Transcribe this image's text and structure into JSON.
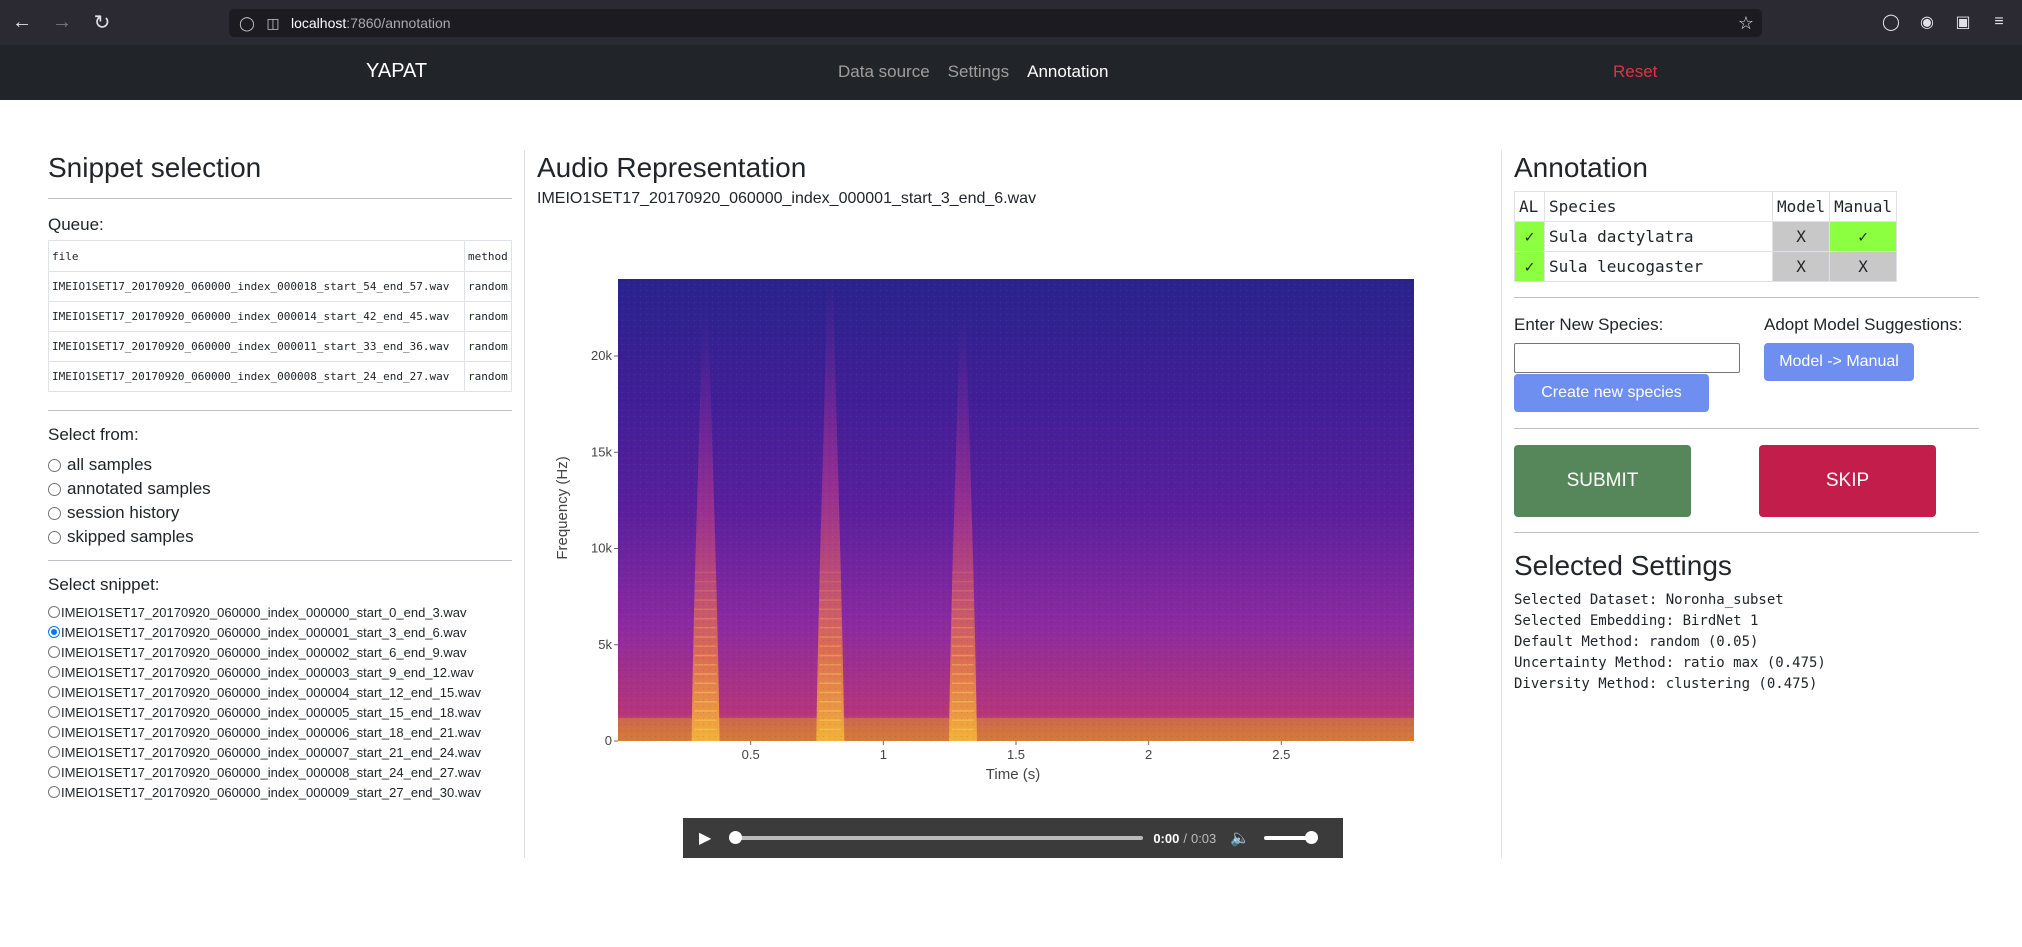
{
  "browser": {
    "url_host": "localhost",
    "url_path": ":7860/annotation"
  },
  "navbar": {
    "brand": "YAPAT",
    "links": [
      {
        "label": "Data source",
        "active": false
      },
      {
        "label": "Settings",
        "active": false
      },
      {
        "label": "Annotation",
        "active": true
      }
    ],
    "reset": "Reset"
  },
  "left": {
    "title": "Snippet selection",
    "queue_label": "Queue:",
    "queue_headers": [
      "file",
      "method"
    ],
    "queue_rows": [
      [
        "IMEIO1SET17_20170920_060000_index_000018_start_54_end_57.wav",
        "random"
      ],
      [
        "IMEIO1SET17_20170920_060000_index_000014_start_42_end_45.wav",
        "random"
      ],
      [
        "IMEIO1SET17_20170920_060000_index_000011_start_33_end_36.wav",
        "random"
      ],
      [
        "IMEIO1SET17_20170920_060000_index_000008_start_24_end_27.wav",
        "random"
      ]
    ],
    "select_from_label": "Select from:",
    "select_from_options": [
      "all samples",
      "annotated samples",
      "session history",
      "skipped samples"
    ],
    "select_snippet_label": "Select snippet:",
    "snippets": [
      "IMEIO1SET17_20170920_060000_index_000000_start_0_end_3.wav",
      "IMEIO1SET17_20170920_060000_index_000001_start_3_end_6.wav",
      "IMEIO1SET17_20170920_060000_index_000002_start_6_end_9.wav",
      "IMEIO1SET17_20170920_060000_index_000003_start_9_end_12.wav",
      "IMEIO1SET17_20170920_060000_index_000004_start_12_end_15.wav",
      "IMEIO1SET17_20170920_060000_index_000005_start_15_end_18.wav",
      "IMEIO1SET17_20170920_060000_index_000006_start_18_end_21.wav",
      "IMEIO1SET17_20170920_060000_index_000007_start_21_end_24.wav",
      "IMEIO1SET17_20170920_060000_index_000008_start_24_end_27.wav",
      "IMEIO1SET17_20170920_060000_index_000009_start_27_end_30.wav"
    ],
    "selected_snippet_index": 1
  },
  "middle": {
    "title": "Audio Representation",
    "filename": "IMEIO1SET17_20170920_060000_index_000001_start_3_end_6.wav",
    "audio": {
      "current": "0:00",
      "separator": "/",
      "duration": "0:03",
      "progress": 0.0,
      "volume": 1.0
    }
  },
  "chart_data": {
    "type": "heatmap",
    "title": "",
    "xlabel": "Time (s)",
    "ylabel": "Frequency (Hz)",
    "xlim": [
      0,
      3
    ],
    "ylim": [
      0,
      24000
    ],
    "x_ticks": [
      0.5,
      1,
      1.5,
      2,
      2.5
    ],
    "x_tick_labels": [
      "0.5",
      "1",
      "1.5",
      "2",
      "2.5"
    ],
    "y_ticks": [
      0,
      5000,
      10000,
      15000,
      20000
    ],
    "y_tick_labels": [
      "0",
      "5k",
      "10k",
      "15k",
      "20k"
    ],
    "colormap": "plasma",
    "call_events": [
      {
        "time": 0.33,
        "max_freq": 22000
      },
      {
        "time": 0.8,
        "max_freq": 24000
      },
      {
        "time": 1.3,
        "max_freq": 22000
      }
    ],
    "colors": {
      "low": "#2a1e8c",
      "mid": "#8a2aa6",
      "high": "#f0a030"
    }
  },
  "right": {
    "title": "Annotation",
    "table_headers": [
      "AL",
      "Species",
      "Model",
      "Manual"
    ],
    "table_rows": [
      {
        "al": "✓",
        "species": "Sula dactylatra",
        "model": "X",
        "manual": "✓"
      },
      {
        "al": "✓",
        "species": "Sula leucogaster",
        "model": "X",
        "manual": "X"
      }
    ],
    "enter_species_label": "Enter New Species:",
    "species_input_value": "",
    "adopt_label": "Adopt Model Suggestions:",
    "model_manual_button": "Model -> Manual",
    "create_species_button": "Create new species",
    "submit_button": "SUBMIT",
    "skip_button": "SKIP",
    "settings_title": "Selected Settings",
    "settings_lines": [
      "Selected Dataset: Noronha_subset",
      "Selected Embedding: BirdNet 1",
      "Default Method: random (0.05)",
      "Uncertainty Method: ratio max (0.475)",
      "Diversity Method: clustering (0.475)"
    ]
  }
}
